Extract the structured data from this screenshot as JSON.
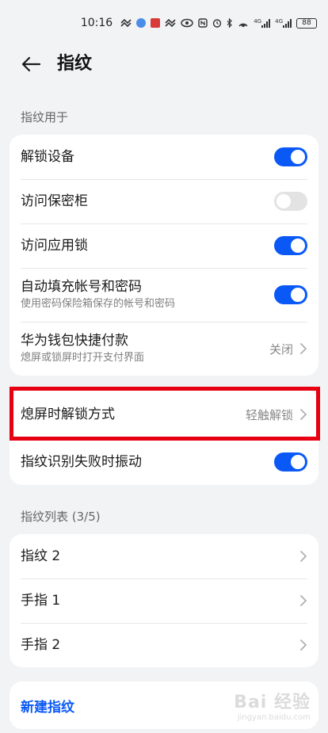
{
  "status_bar": {
    "time": "10:16",
    "battery": "88",
    "network_labels": [
      "4G",
      "4G"
    ]
  },
  "header": {
    "title": "指纹",
    "back_icon": "arrow-left-icon"
  },
  "section_usage": {
    "label": "指纹用于",
    "items": [
      {
        "title": "解锁设备",
        "toggle": "on"
      },
      {
        "title": "访问保密柜",
        "toggle": "off"
      },
      {
        "title": "访问应用锁",
        "toggle": "on"
      },
      {
        "title": "自动填充帐号和密码",
        "subtitle": "使用密码保险箱保存的帐号和密码",
        "toggle": "on"
      },
      {
        "title": "华为钱包快捷付款",
        "subtitle": "熄屏或锁屏时打开支付界面",
        "value": "关闭"
      }
    ]
  },
  "section_unlock": {
    "items": [
      {
        "title": "熄屏时解锁方式",
        "value": "轻触解锁"
      },
      {
        "title": "指纹识别失败时振动",
        "toggle": "on"
      }
    ]
  },
  "section_list": {
    "label": "指纹列表 (3/5)",
    "items": [
      {
        "title": "指纹 2"
      },
      {
        "title": "手指 1"
      },
      {
        "title": "手指 2"
      }
    ]
  },
  "create": {
    "label": "新建指纹"
  },
  "watermark": {
    "logo": "Bai 经验",
    "url": "jingyan.baidu.com"
  },
  "colors": {
    "accent": "#0a59f7",
    "highlight": "#e60012",
    "background": "#f1f3f5"
  }
}
